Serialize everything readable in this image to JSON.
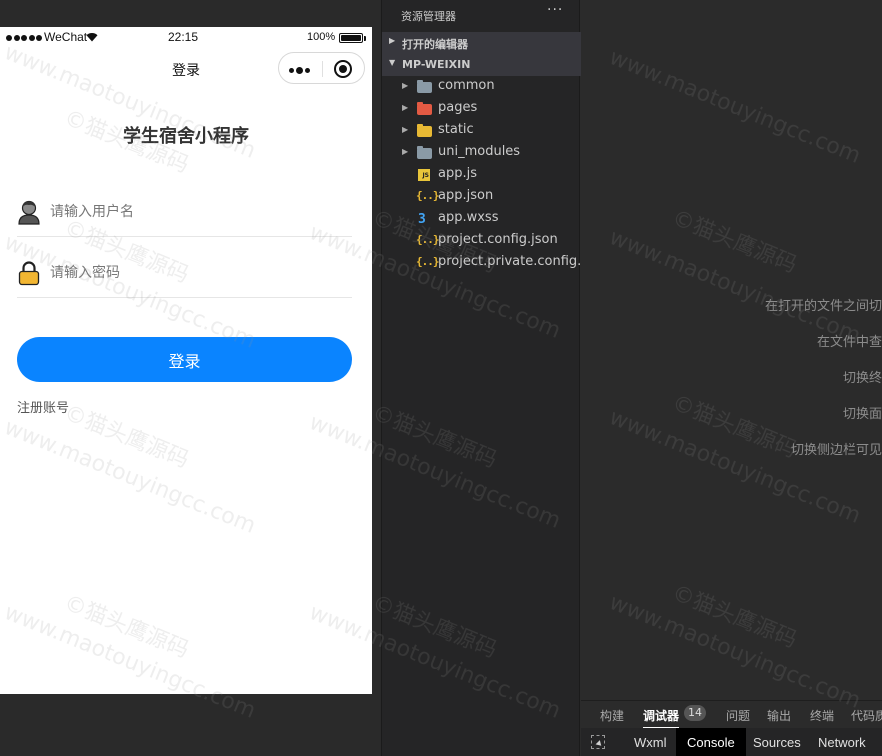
{
  "simulator": {
    "status_bar": {
      "carrier": "WeChat",
      "time": "22:15",
      "battery": "100%"
    },
    "navbar": {
      "title": "登录"
    },
    "app_title": "学生宿舍小程序",
    "username": {
      "placeholder": "请输入用户名",
      "icon": "user-avatar-icon"
    },
    "password": {
      "placeholder": "请输入密码",
      "icon": "lock-icon"
    },
    "login_button": "登录",
    "register_link": "注册账号",
    "colors": {
      "primary": "#0a84ff"
    }
  },
  "explorer": {
    "title": "资源管理器",
    "more": "···",
    "open_editors_label": "打开的编辑器",
    "project_label": "MP-WEIXIN",
    "items": [
      {
        "name": "common",
        "kind": "folder",
        "icon": "folder-icon",
        "color": "#8a9aa6"
      },
      {
        "name": "pages",
        "kind": "folder",
        "icon": "pages-folder-icon",
        "color": "#e35a43"
      },
      {
        "name": "static",
        "kind": "folder",
        "icon": "static-folder-icon",
        "color": "#e8b934"
      },
      {
        "name": "uni_modules",
        "kind": "folder",
        "icon": "folder-icon",
        "color": "#8a9aa6"
      },
      {
        "name": "app.js",
        "kind": "js",
        "icon": "js-file-icon"
      },
      {
        "name": "app.json",
        "kind": "json",
        "icon": "json-file-icon"
      },
      {
        "name": "app.wxss",
        "kind": "css",
        "icon": "css-file-icon"
      },
      {
        "name": "project.config.json",
        "kind": "json",
        "icon": "json-file-icon"
      },
      {
        "name": "project.private.config.js...",
        "kind": "json",
        "icon": "json-file-icon"
      }
    ]
  },
  "editor": {
    "hints": [
      "在打开的文件之间切",
      "在文件中查",
      "切换终",
      "切换面",
      "切换侧边栏可见"
    ]
  },
  "bottom_panel": {
    "tabs": [
      "构建",
      "调试器",
      "问题",
      "输出",
      "终端",
      "代码质"
    ],
    "debugger_badge": "14",
    "devtools_tabs": [
      "Wxml",
      "Console",
      "Sources",
      "Network"
    ],
    "active_devtools_tab": "Console"
  },
  "watermark": {
    "lines": [
      "www.maotouyingcc.com",
      "©猫头鹰源码"
    ]
  }
}
